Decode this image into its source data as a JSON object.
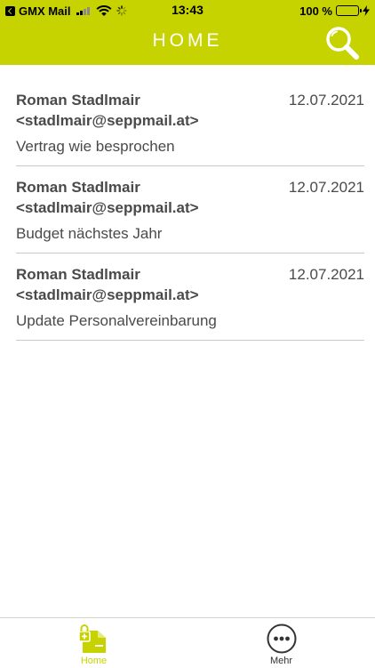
{
  "status_bar": {
    "carrier": "GMX Mail",
    "time": "13:43",
    "battery": "100 %"
  },
  "header": {
    "title": "HOME",
    "icon": "search-icon"
  },
  "mails": [
    {
      "sender": "Roman Stadlmair",
      "email": "<stadlmair@seppmail.at>",
      "subject": "Vertrag wie besprochen",
      "date": "12.07.2021"
    },
    {
      "sender": "Roman Stadlmair",
      "email": "<stadlmair@seppmail.at>",
      "subject": "Budget nächstes Jahr",
      "date": "12.07.2021"
    },
    {
      "sender": "Roman Stadlmair",
      "email": "<stadlmair@seppmail.at>",
      "subject": "Update Personalvereinbarung",
      "date": "12.07.2021"
    }
  ],
  "tabbar": {
    "home_label": "Home",
    "more_label": "Mehr"
  },
  "colors": {
    "accent": "#c7d300",
    "text": "#4a4a4a"
  }
}
